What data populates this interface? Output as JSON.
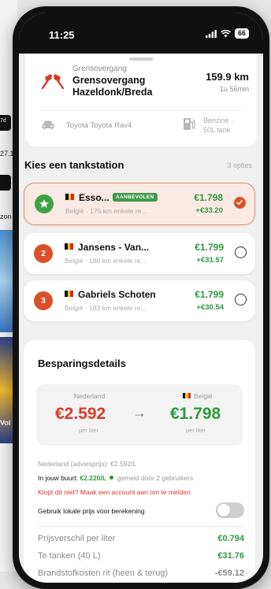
{
  "background_app": {
    "snippets": [
      "7d",
      "27.1",
      "zon",
      "Vol"
    ]
  },
  "status": {
    "time": "11:25",
    "battery": "66"
  },
  "route": {
    "kicker": "Grensovergang",
    "name": "Grensovergang Hazeldonk/Breda",
    "distance": "159.9 km",
    "duration": "1u 56min",
    "car": "Toyota Toyota Rav4",
    "fuel_line1": "Benzine ·",
    "fuel_line2": "50L tank"
  },
  "stations_section": {
    "title": "Kies een tankstation",
    "count": "3 opties"
  },
  "stations": [
    {
      "rank": "",
      "name": "Esso...",
      "tag": "AANBEVOLEN",
      "sub": "België · 175 km enkele re...",
      "price": "€1.798",
      "saving": "+€33.20",
      "selected": true
    },
    {
      "rank": "2",
      "name": "Jansens - Van...",
      "tag": "",
      "sub": "België · 180 km enkele re...",
      "price": "€1.799",
      "saving": "+€31.57",
      "selected": false
    },
    {
      "rank": "3",
      "name": "Gabriels Schoten",
      "tag": "",
      "sub": "België · 183 km enkele re...",
      "price": "€1.799",
      "saving": "+€30.54",
      "selected": false
    }
  ],
  "details": {
    "title": "Besparingsdetails",
    "from_label": "Nederland",
    "from_price": "€2.592",
    "from_unit": "per liter",
    "to_label": "België",
    "to_price": "€1.798",
    "to_unit": "per liter",
    "advice_line": "Nederland (adviesprijs): €2.592/L",
    "nearby_label": "In jouw buurt:",
    "nearby_price": "€2.220/L",
    "nearby_note": "gemeld door 2 gebruikers",
    "report_link": "Klopt dit niet? Maak een account aan om te melden",
    "toggle_label": "Gebruik lokale prijs voor berekening",
    "toggle_on": false,
    "rows": [
      {
        "label": "Prijsverschil per liter",
        "value": "€0.794"
      },
      {
        "label": "Te tanken (40 L)",
        "value": "€31.76"
      },
      {
        "label": "Brandstofkosten rit (heen & terug)",
        "value": "-€59.12"
      }
    ]
  },
  "colors": {
    "accent": "#d9512c",
    "green": "#2d9a3e",
    "red": "#d63a2a",
    "recommended_bg": "#fbe9e4"
  }
}
